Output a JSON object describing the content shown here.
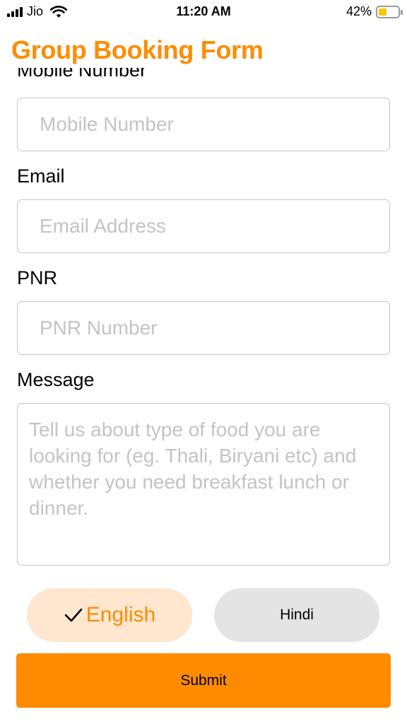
{
  "status_bar": {
    "carrier": "Jio",
    "time": "11:20 AM",
    "battery_percent": "42%",
    "battery_level": 0.42,
    "icons": [
      "signal-icon",
      "wifi-icon",
      "battery-icon"
    ]
  },
  "header": {
    "title": "Group Booking Form"
  },
  "colors": {
    "accent": "#ff8c00",
    "accent_light": "#ffe6cf",
    "neutral_pill": "#e4e4e4"
  },
  "form": {
    "mobile": {
      "label": "Mobile Number",
      "placeholder": "Mobile Number",
      "value": ""
    },
    "email": {
      "label": "Email",
      "placeholder": "Email Address",
      "value": ""
    },
    "pnr": {
      "label": "PNR",
      "placeholder": "PNR Number",
      "value": ""
    },
    "message": {
      "label": "Message",
      "placeholder": "Tell us about type of food you are looking for (eg. Thali, Biryani etc) and whether you need breakfast lunch or dinner.",
      "value": ""
    }
  },
  "language": {
    "options": [
      "English",
      "Hindi"
    ],
    "selected": "English"
  },
  "actions": {
    "submit_label": "Submit"
  }
}
